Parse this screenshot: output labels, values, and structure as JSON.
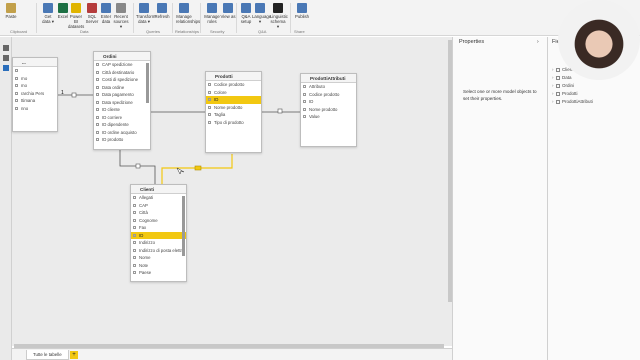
{
  "ribbon": {
    "buttons": [
      {
        "id": "paste",
        "label": "Paste",
        "icon": "paste-icon",
        "color": "#c2a04a"
      },
      {
        "id": "get-data",
        "label": "Get data ▾",
        "icon": "database-icon",
        "color": "#4a78b5"
      },
      {
        "id": "excel",
        "label": "Excel",
        "icon": "excel-icon",
        "color": "#1d7044"
      },
      {
        "id": "power-bi",
        "label": "Power BI datasets",
        "icon": "dataset-icon",
        "color": "#e0b400"
      },
      {
        "id": "sql-server",
        "label": "SQL Server",
        "icon": "sql-icon",
        "color": "#b53c3c"
      },
      {
        "id": "enter-data",
        "label": "Enter data",
        "icon": "table-icon",
        "color": "#4a78b5"
      },
      {
        "id": "recent-sources",
        "label": "Recent sources ▾",
        "icon": "recent-icon",
        "color": "#888888"
      },
      {
        "id": "transform-data",
        "label": "Transform data ▾",
        "icon": "transform-icon",
        "color": "#4a78b5"
      },
      {
        "id": "refresh",
        "label": "Refresh",
        "icon": "refresh-icon",
        "color": "#4a78b5"
      },
      {
        "id": "manage-relationships",
        "label": "Manage relationships",
        "icon": "relationships-icon",
        "color": "#4a78b5"
      },
      {
        "id": "manage-roles",
        "label": "Manage roles",
        "icon": "roles-icon",
        "color": "#4a78b5"
      },
      {
        "id": "view-as",
        "label": "View as",
        "icon": "view-as-icon",
        "color": "#4a78b5"
      },
      {
        "id": "qa-setup",
        "label": "Q&A setup",
        "icon": "qa-icon",
        "color": "#4a78b5"
      },
      {
        "id": "language",
        "label": "Language ▾",
        "icon": "language-icon",
        "color": "#4a78b5"
      },
      {
        "id": "linguistic-schema",
        "label": "Linguistic schema ▾",
        "icon": "linguistic-icon",
        "color": "#222222"
      },
      {
        "id": "publish",
        "label": "Publish",
        "icon": "publish-icon",
        "color": "#4a78b5"
      }
    ],
    "groups": [
      "Clipboard",
      "Data",
      "Queries",
      "Relationships",
      "Security",
      "Q&A",
      "Share"
    ]
  },
  "tables": {
    "partial": {
      "title": "...",
      "rows": [
        "",
        "rno",
        "mo",
        "rarchia Pers",
        "ttimana",
        "nno"
      ]
    },
    "ordini": {
      "title": "Ordini",
      "rows": [
        "CAP spedizione",
        "Città destinatario",
        "Costi di spedizione",
        "Data ordine",
        "Data pagamento",
        "Data spedizione",
        "ID cliente",
        "ID corriere",
        "ID dipendente",
        "ID ordine acquisto",
        "ID prodotto"
      ]
    },
    "prodotti": {
      "title": "Prodotti",
      "rows": [
        "Codice prodotto",
        "Colore",
        "ID",
        "Nome prodotto",
        "Taglia",
        "Tipo di prodotto"
      ],
      "selected": 2
    },
    "prodottiattributi": {
      "title": "ProdottiAttributi",
      "rows": [
        "Attributo",
        "Codice prodotto",
        "ID",
        "Nome prodotto",
        "Value"
      ]
    },
    "clienti": {
      "title": "Clienti",
      "rows": [
        "Allegati",
        "CAP",
        "Città",
        "Cognome",
        "Fax",
        "ID",
        "Indirizzo",
        "Indirizzo di posta elettr...",
        "Nome",
        "Note",
        "Paese"
      ],
      "selected": 5
    }
  },
  "relationships": [
    {
      "from": "Ordini",
      "to": "Prodotti",
      "cardinality_from": "*",
      "cardinality_to": "1"
    },
    {
      "from": "Ordini",
      "to": "Clienti",
      "cardinality_from": "*",
      "cardinality_to": "1"
    },
    {
      "from": "Prodotti",
      "to": "ProdottiAttributi",
      "cardinality_from": "1",
      "cardinality_to": "*"
    },
    {
      "from": "Prodotti",
      "to": "Clienti",
      "highlighted": true
    }
  ],
  "properties": {
    "title": "Properties",
    "message": "Select one or more model objects to set their properties."
  },
  "fields": {
    "title": "Fields",
    "items": [
      "Clienti",
      "Data",
      "Ordini",
      "Prodotti",
      "ProdottiAttributi"
    ]
  },
  "tabs": {
    "items": [
      "Tutte le tabelle"
    ],
    "add": "+"
  },
  "colors": {
    "accent": "#f2c811",
    "canvas": "#ebebeb"
  }
}
